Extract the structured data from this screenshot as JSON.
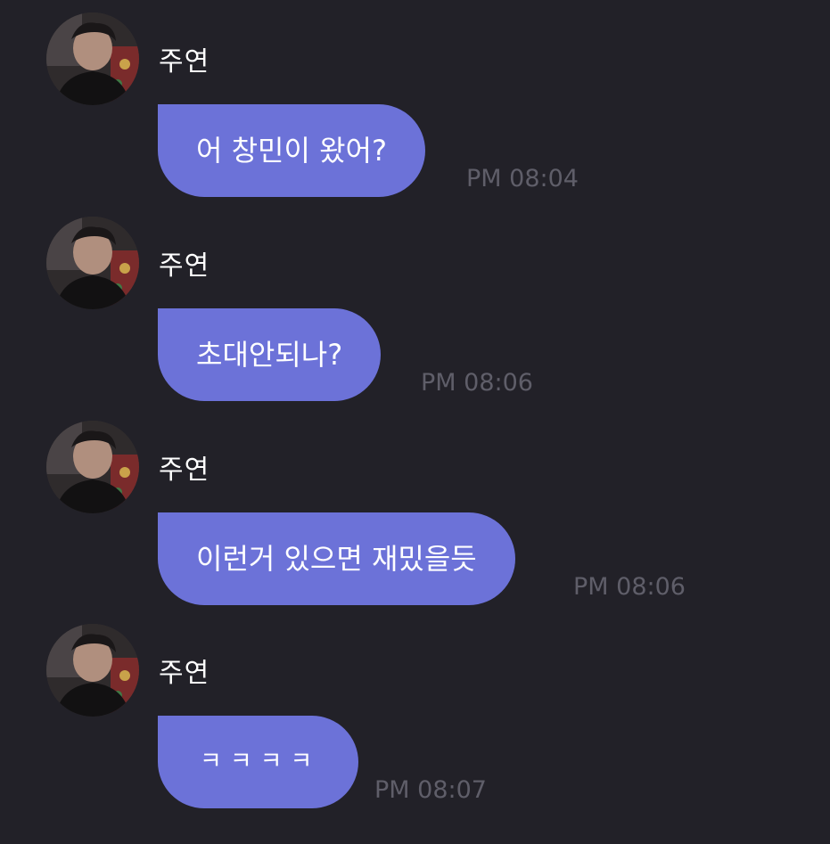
{
  "messages": [
    {
      "sender": "주연",
      "text": "어 창민이 왔어?",
      "time": "PM 08:04",
      "avatar_icon": "profile-photo"
    },
    {
      "sender": "주연",
      "text": "초대안되나?",
      "time": "PM 08:06",
      "avatar_icon": "profile-photo"
    },
    {
      "sender": "주연",
      "text": "이런거 있으면 재밌을듯",
      "time": "PM 08:06",
      "avatar_icon": "profile-photo"
    },
    {
      "sender": "주연",
      "text": "ㅋㅋㅋㅋ",
      "time": "PM 08:07",
      "avatar_icon": "profile-photo"
    }
  ],
  "colors": {
    "background": "#222128",
    "bubble": "#6c72d8",
    "sender_text": "#ffffff",
    "time_text": "#5f5e69"
  }
}
